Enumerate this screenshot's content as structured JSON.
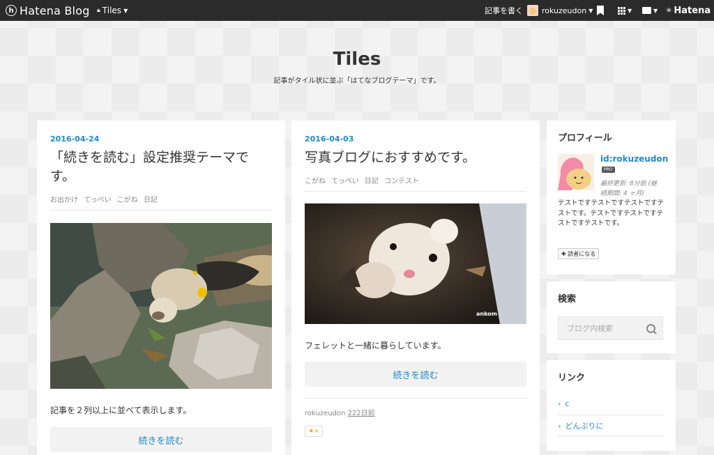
{
  "topbar": {
    "logo_mark": "h",
    "brand": "Hatena Blog",
    "blog_menu": "Tiles",
    "write_label": "記事を書く",
    "user_label": "rokuzeudon",
    "hatena_label": "Hatena"
  },
  "header": {
    "title": "Tiles",
    "description": "記事がタイル状に並ぶ「はてなブログテーマ」です。"
  },
  "entries": [
    {
      "date": "2016-04-24",
      "title": "「続きを読む」設定推奨テーマです。",
      "categories": [
        "お出かけ",
        "てっぺい",
        "こがね",
        "日記"
      ],
      "excerpt": "記事を２列以上に並べて表示します。",
      "more": "続きを読む"
    },
    {
      "date": "2016-04-03",
      "title": "写真ブログにおすすめです。",
      "categories": [
        "こがね",
        "てっぺい",
        "日記",
        "コンテスト"
      ],
      "excerpt": "フェレットと一緒に暮らしています。",
      "more": "続きを読む",
      "author": "rokuzeudon",
      "ago": "222日前",
      "star": "★+",
      "photo_caption": "ankom"
    }
  ],
  "sidebar": {
    "profile": {
      "heading": "プロフィール",
      "id": "id:rokuzeudon",
      "badge": "PRO",
      "updated": "最終更新: 8分前 (継",
      "period": "続期間: 4 ヶ月)",
      "description": "テストですテストですテストですテストです。テストですテストですテストですテストです。",
      "reader_button": "✚ 読者になる"
    },
    "search": {
      "heading": "検索",
      "placeholder": "ブログ内検索"
    },
    "links": {
      "heading": "リンク",
      "items": [
        "c",
        "どんぶりに"
      ]
    }
  }
}
